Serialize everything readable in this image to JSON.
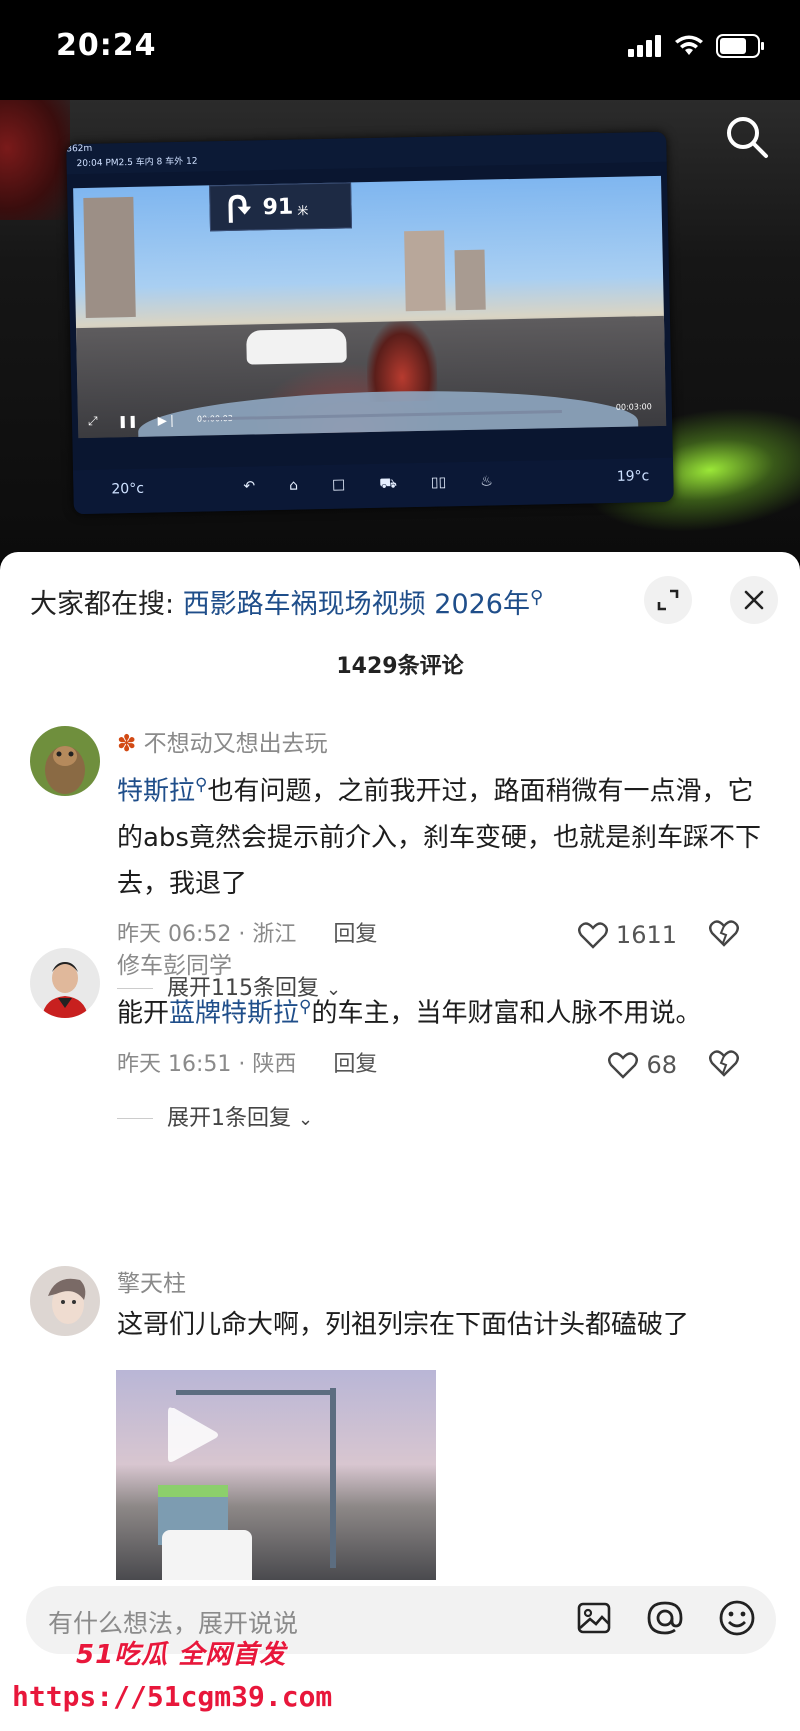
{
  "status_bar": {
    "time": "20:24"
  },
  "video": {
    "screen_top_left": "20:04  PM2.5  车内 8  车外 12",
    "screen_top_right": "362m",
    "nav_distance": "91",
    "nav_unit": "米",
    "playback_start": "00:00:03",
    "playback_end": "00:03:00",
    "temp_left": "20°c",
    "temp_right": "19°c"
  },
  "panel": {
    "hot_search_prefix": "大家都在搜: ",
    "hot_search_term": "西影路车祸现场视频 2026年",
    "comment_count": "1429条评论"
  },
  "comments": [
    {
      "author": "不想动又想出去玩",
      "keyword": "特斯拉",
      "text": "也有问题，之前我开过，路面稍微有一点滑，它的abs竟然会提示前介入，刹车变硬，也就是刹车踩不下去，我退了",
      "time_location": "昨天 06:52 · 浙江",
      "reply_label": "回复",
      "likes": "1611",
      "expand_replies": "展开115条回复"
    },
    {
      "author": "修车彭同学",
      "text_prefix": "能开",
      "keyword": "蓝牌特斯拉",
      "text": "的车主，当年财富和人脉不用说。",
      "time_location": "昨天 16:51 · 陕西",
      "reply_label": "回复",
      "likes": "68",
      "expand_replies": "展开1条回复"
    },
    {
      "author": "擎天柱",
      "text": "这哥们儿命大啊，列祖列宗在下面估计头都磕破了"
    }
  ],
  "input": {
    "placeholder": "有什么想法，展开说说"
  },
  "watermark": {
    "brand": "51吃瓜 全网首发",
    "url": "https://51cgm39.com"
  },
  "colors": {
    "link_blue": "#1f4e8a",
    "watermark_red": "#e8173b"
  }
}
